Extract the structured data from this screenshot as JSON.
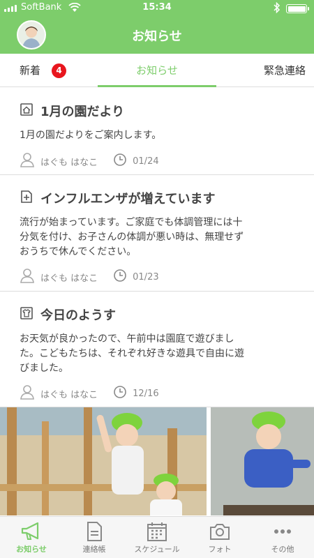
{
  "status_bar": {
    "carrier": "SoftBank",
    "time": "15:34"
  },
  "header": {
    "title": "お知らせ"
  },
  "tabs": [
    {
      "label": "新着",
      "badge": "4"
    },
    {
      "label": "お知らせ"
    },
    {
      "label": "緊急連絡"
    }
  ],
  "notices": [
    {
      "icon": "house-icon",
      "title": "1月の園だより",
      "body_lines": [
        "1月の園だよりをご案内します。"
      ],
      "author": "はぐも はなこ",
      "date": "01/24"
    },
    {
      "icon": "plus-document-icon",
      "title": "インフルエンザが増えています",
      "body_lines": [
        "流行が始まっています。ご家庭でも体調管理には十",
        "分気を付け、お子さんの体調が悪い時は、無理せず",
        "おうちで休んでください。"
      ],
      "author": "はぐも はなこ",
      "date": "01/23"
    },
    {
      "icon": "shirt-icon",
      "title": "今日のようす",
      "body_lines": [
        "お天気が良かったので、午前中は園庭で遊びまし",
        "た。こどもたちは、それぞれ好きな遊具で自由に遊",
        "びました。"
      ],
      "author": "はぐも はなこ",
      "date": "12/16"
    }
  ],
  "bottom_nav": [
    {
      "label": "お知らせ",
      "icon": "megaphone-icon",
      "active": true
    },
    {
      "label": "連絡帳",
      "icon": "notebook-icon",
      "active": false
    },
    {
      "label": "スケジュール",
      "icon": "calendar-icon",
      "active": false
    },
    {
      "label": "フォト",
      "icon": "camera-icon",
      "active": false
    },
    {
      "label": "その他",
      "icon": "more-icon",
      "active": false
    }
  ],
  "colors": {
    "accent": "#7dcd6b",
    "badge": "#e8161e"
  }
}
